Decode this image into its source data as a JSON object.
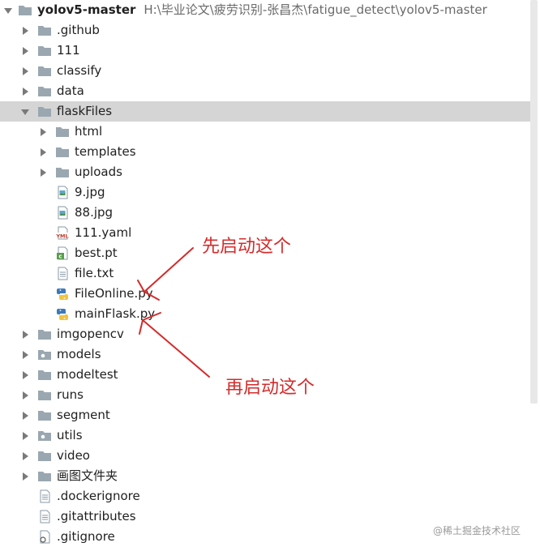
{
  "project": {
    "name": "yolov5-master",
    "path": "H:\\毕业论文\\疲劳识别-张昌杰\\fatigue_detect\\yolov5-master"
  },
  "items": [
    {
      "label": ".github",
      "type": "folder",
      "depth": 1,
      "expanded": false
    },
    {
      "label": "111",
      "type": "folder",
      "depth": 1,
      "expanded": false
    },
    {
      "label": "classify",
      "type": "folder",
      "depth": 1,
      "expanded": false
    },
    {
      "label": "data",
      "type": "folder",
      "depth": 1,
      "expanded": false
    },
    {
      "label": "flaskFiles",
      "type": "folder",
      "depth": 1,
      "expanded": true,
      "selected": true
    },
    {
      "label": "html",
      "type": "folder",
      "depth": 2,
      "expanded": false
    },
    {
      "label": "templates",
      "type": "folder",
      "depth": 2,
      "expanded": false
    },
    {
      "label": "uploads",
      "type": "folder",
      "depth": 2,
      "expanded": false
    },
    {
      "label": "9.jpg",
      "type": "image",
      "depth": 2
    },
    {
      "label": "88.jpg",
      "type": "image",
      "depth": 2
    },
    {
      "label": "111.yaml",
      "type": "yaml",
      "depth": 2
    },
    {
      "label": "best.pt",
      "type": "pt",
      "depth": 2
    },
    {
      "label": "file.txt",
      "type": "text",
      "depth": 2
    },
    {
      "label": "FileOnline.py",
      "type": "python",
      "depth": 2
    },
    {
      "label": "mainFlask.py",
      "type": "python",
      "depth": 2
    },
    {
      "label": "imgopencv",
      "type": "folder",
      "depth": 1,
      "expanded": false
    },
    {
      "label": "models",
      "type": "package",
      "depth": 1,
      "expanded": false
    },
    {
      "label": "modeltest",
      "type": "folder",
      "depth": 1,
      "expanded": false
    },
    {
      "label": "runs",
      "type": "folder",
      "depth": 1,
      "expanded": false
    },
    {
      "label": "segment",
      "type": "folder",
      "depth": 1,
      "expanded": false
    },
    {
      "label": "utils",
      "type": "package",
      "depth": 1,
      "expanded": false
    },
    {
      "label": "video",
      "type": "folder",
      "depth": 1,
      "expanded": false
    },
    {
      "label": "画图文件夹",
      "type": "folder",
      "depth": 1,
      "expanded": false
    },
    {
      "label": ".dockerignore",
      "type": "text",
      "depth": 1
    },
    {
      "label": ".gitattributes",
      "type": "text",
      "depth": 1
    },
    {
      "label": ".gitignore",
      "type": "gitignore",
      "depth": 1
    }
  ],
  "annotations": {
    "first": "先启动这个",
    "second": "再启动这个",
    "color": "#d42b2b"
  },
  "watermark": "@稀土掘金技术社区",
  "colors": {
    "folder": "#9aa7b0",
    "selected_row": "#d5d5d5",
    "path_text": "#6a6a6a"
  }
}
